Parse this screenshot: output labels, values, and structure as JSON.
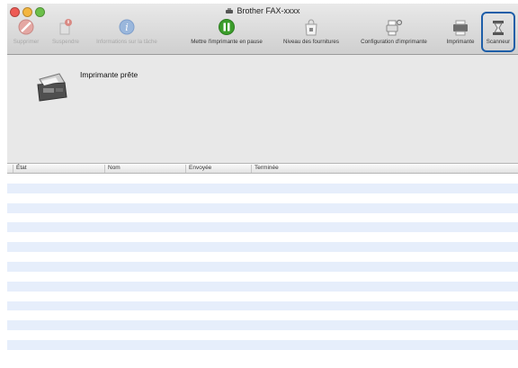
{
  "window": {
    "title": "Brother FAX-xxxx"
  },
  "toolbar": {
    "delete_label": "Supprimer",
    "pause_label": "Suspendre",
    "job_info_label": "Informations sur la tâche",
    "pause_printer_label": "Mettre l'imprimante en pause",
    "supply_levels_label": "Niveau des fournitures",
    "printer_setup_label": "Configuration d'imprimante",
    "printer_label": "Imprimante",
    "scanner_label": "Scanneur"
  },
  "status": {
    "message": "Imprimante prête"
  },
  "table": {
    "columns": [
      "État",
      "Nom",
      "Envoyée",
      "Terminée"
    ],
    "rows": []
  },
  "colors": {
    "accent": "#1e5ea8",
    "stripe": "#e6eefb",
    "pause_green": "#3a9d2a"
  }
}
